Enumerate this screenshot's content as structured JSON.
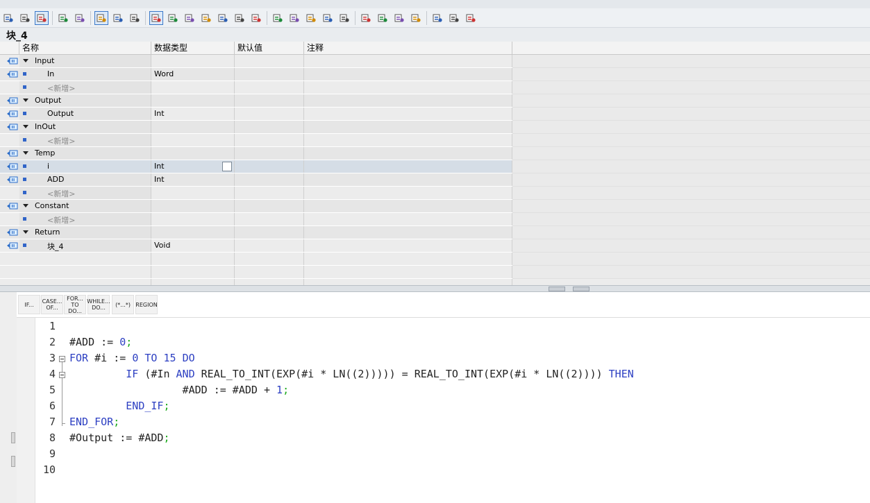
{
  "block": {
    "title": "块_4"
  },
  "table": {
    "headers": {
      "name": "名称",
      "type": "数据类型",
      "default": "默认值",
      "comment": "注释"
    },
    "rows": [
      {
        "kind": "section",
        "name": "Input",
        "type": ""
      },
      {
        "kind": "item",
        "name": "In",
        "type": "Word"
      },
      {
        "kind": "new",
        "name": "<新增>",
        "type": ""
      },
      {
        "kind": "section",
        "name": "Output",
        "type": ""
      },
      {
        "kind": "item",
        "name": "Output",
        "type": "Int"
      },
      {
        "kind": "section",
        "name": "InOut",
        "type": ""
      },
      {
        "kind": "new",
        "name": "<新增>",
        "type": ""
      },
      {
        "kind": "section",
        "name": "Temp",
        "type": ""
      },
      {
        "kind": "item",
        "name": "i",
        "type": "Int",
        "selected": true
      },
      {
        "kind": "item",
        "name": "ADD",
        "type": "Int"
      },
      {
        "kind": "new",
        "name": "<新增>",
        "type": ""
      },
      {
        "kind": "section",
        "name": "Constant",
        "type": ""
      },
      {
        "kind": "new",
        "name": "<新增>",
        "type": ""
      },
      {
        "kind": "section",
        "name": "Return",
        "type": ""
      },
      {
        "kind": "item",
        "name": "块_4",
        "type": "Void"
      }
    ]
  },
  "snippets": [
    "IF...",
    "CASE... OF...",
    "FOR... TO DO...",
    "WHILE... DO...",
    "(*...*)",
    "REGION"
  ],
  "code": {
    "line_numbers": [
      "1",
      "2",
      "3",
      "4",
      "5",
      "6",
      "7",
      "8",
      "9",
      "10"
    ],
    "lines": [
      {
        "indent": "",
        "tokens": []
      },
      {
        "indent": "",
        "tokens": [
          [
            "var",
            "#ADD"
          ],
          [
            "var",
            " := "
          ],
          [
            "num",
            "0"
          ],
          [
            "semi",
            ";"
          ]
        ]
      },
      {
        "indent": "",
        "tokens": [
          [
            "kw",
            "FOR"
          ],
          [
            "var",
            " #i := "
          ],
          [
            "num",
            "0"
          ],
          [
            "var",
            " "
          ],
          [
            "kw",
            "TO"
          ],
          [
            "var",
            " "
          ],
          [
            "num",
            "15"
          ],
          [
            "var",
            " "
          ],
          [
            "kw",
            "DO"
          ]
        ]
      },
      {
        "indent": "         ",
        "tokens": [
          [
            "kw",
            "IF"
          ],
          [
            "var",
            " (#In "
          ],
          [
            "kw",
            "AND"
          ],
          [
            "var",
            " REAL_TO_INT(EXP(#i * LN((2))))) = REAL_TO_INT(EXP(#i * LN((2)))) "
          ],
          [
            "kw",
            "THEN"
          ]
        ]
      },
      {
        "indent": "                  ",
        "tokens": [
          [
            "var",
            "#ADD := #ADD + "
          ],
          [
            "num",
            "1"
          ],
          [
            "semi",
            ";"
          ]
        ]
      },
      {
        "indent": "         ",
        "tokens": [
          [
            "kw",
            "END_IF"
          ],
          [
            "semi",
            ";"
          ]
        ]
      },
      {
        "indent": "",
        "tokens": [
          [
            "kw",
            "END_FOR"
          ],
          [
            "semi",
            ";"
          ]
        ]
      },
      {
        "indent": "",
        "tokens": [
          [
            "var",
            "#Output := #ADD"
          ],
          [
            "semi",
            ";"
          ]
        ]
      },
      {
        "indent": "",
        "tokens": []
      },
      {
        "indent": "",
        "tokens": []
      }
    ]
  },
  "colors": {
    "keyword": "#2c3fc2",
    "semicolon": "#17a817",
    "accent": "#3a78c8"
  },
  "toolbar_icons": [
    "cursor-icon",
    "insert-network-icon",
    "download-icon",
    "block-icon",
    "list-icon",
    "interface-icon",
    "monitor-icon",
    "absolute-info-icon",
    "delete-breakpoint-icon",
    "delete-icon",
    "refresh-icon",
    "sync-icon",
    "comment-icon",
    "download-arrow-icon",
    "go-to-previous-icon",
    "indent-icon",
    "outdent-icon",
    "format-icon",
    "bookmark-icon",
    "bookmark-next-icon",
    "highlight-icon",
    "step-over-icon",
    "step-back-icon",
    "monitor-search-icon",
    "watch-icon",
    "watch-off-icon",
    "database-icon"
  ]
}
